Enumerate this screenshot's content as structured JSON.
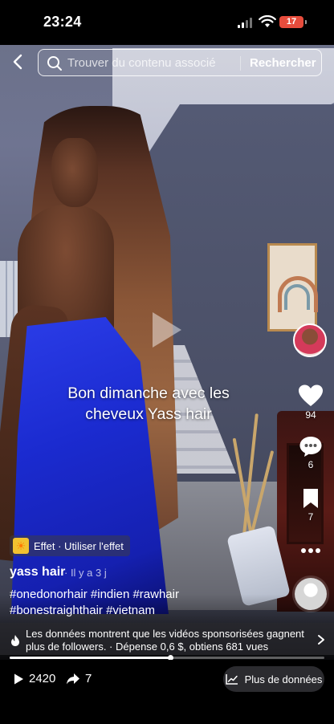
{
  "status_bar": {
    "time": "23:24",
    "battery": "17",
    "battery_color": "#e74c3c"
  },
  "search": {
    "placeholder": "Trouver du contenu associé",
    "button_label": "Rechercher"
  },
  "video": {
    "caption_line1": "Bon dimanche avec les",
    "caption_line2": "cheveux Yass hair"
  },
  "rail": {
    "likes": "94",
    "comments": "6",
    "saves": "7"
  },
  "effect": {
    "label": "Effet · Utiliser l'effet"
  },
  "post": {
    "author": "yass hair",
    "posted": "· Il y a 3 j",
    "hashtags_line1": "#onedonorhair #indien #rawhair",
    "hashtags_line2": "#bonestraighthair #vietnam"
  },
  "promo": {
    "text": "Les données montrent que les vidéos sponsorisées gagnent plus de followers. · Dépense 0,6 $, obtiens 681 vues"
  },
  "playback": {
    "progress_fraction": 0.51
  },
  "stats": {
    "views": "2420",
    "shares": "7",
    "data_button": "Plus de données"
  }
}
